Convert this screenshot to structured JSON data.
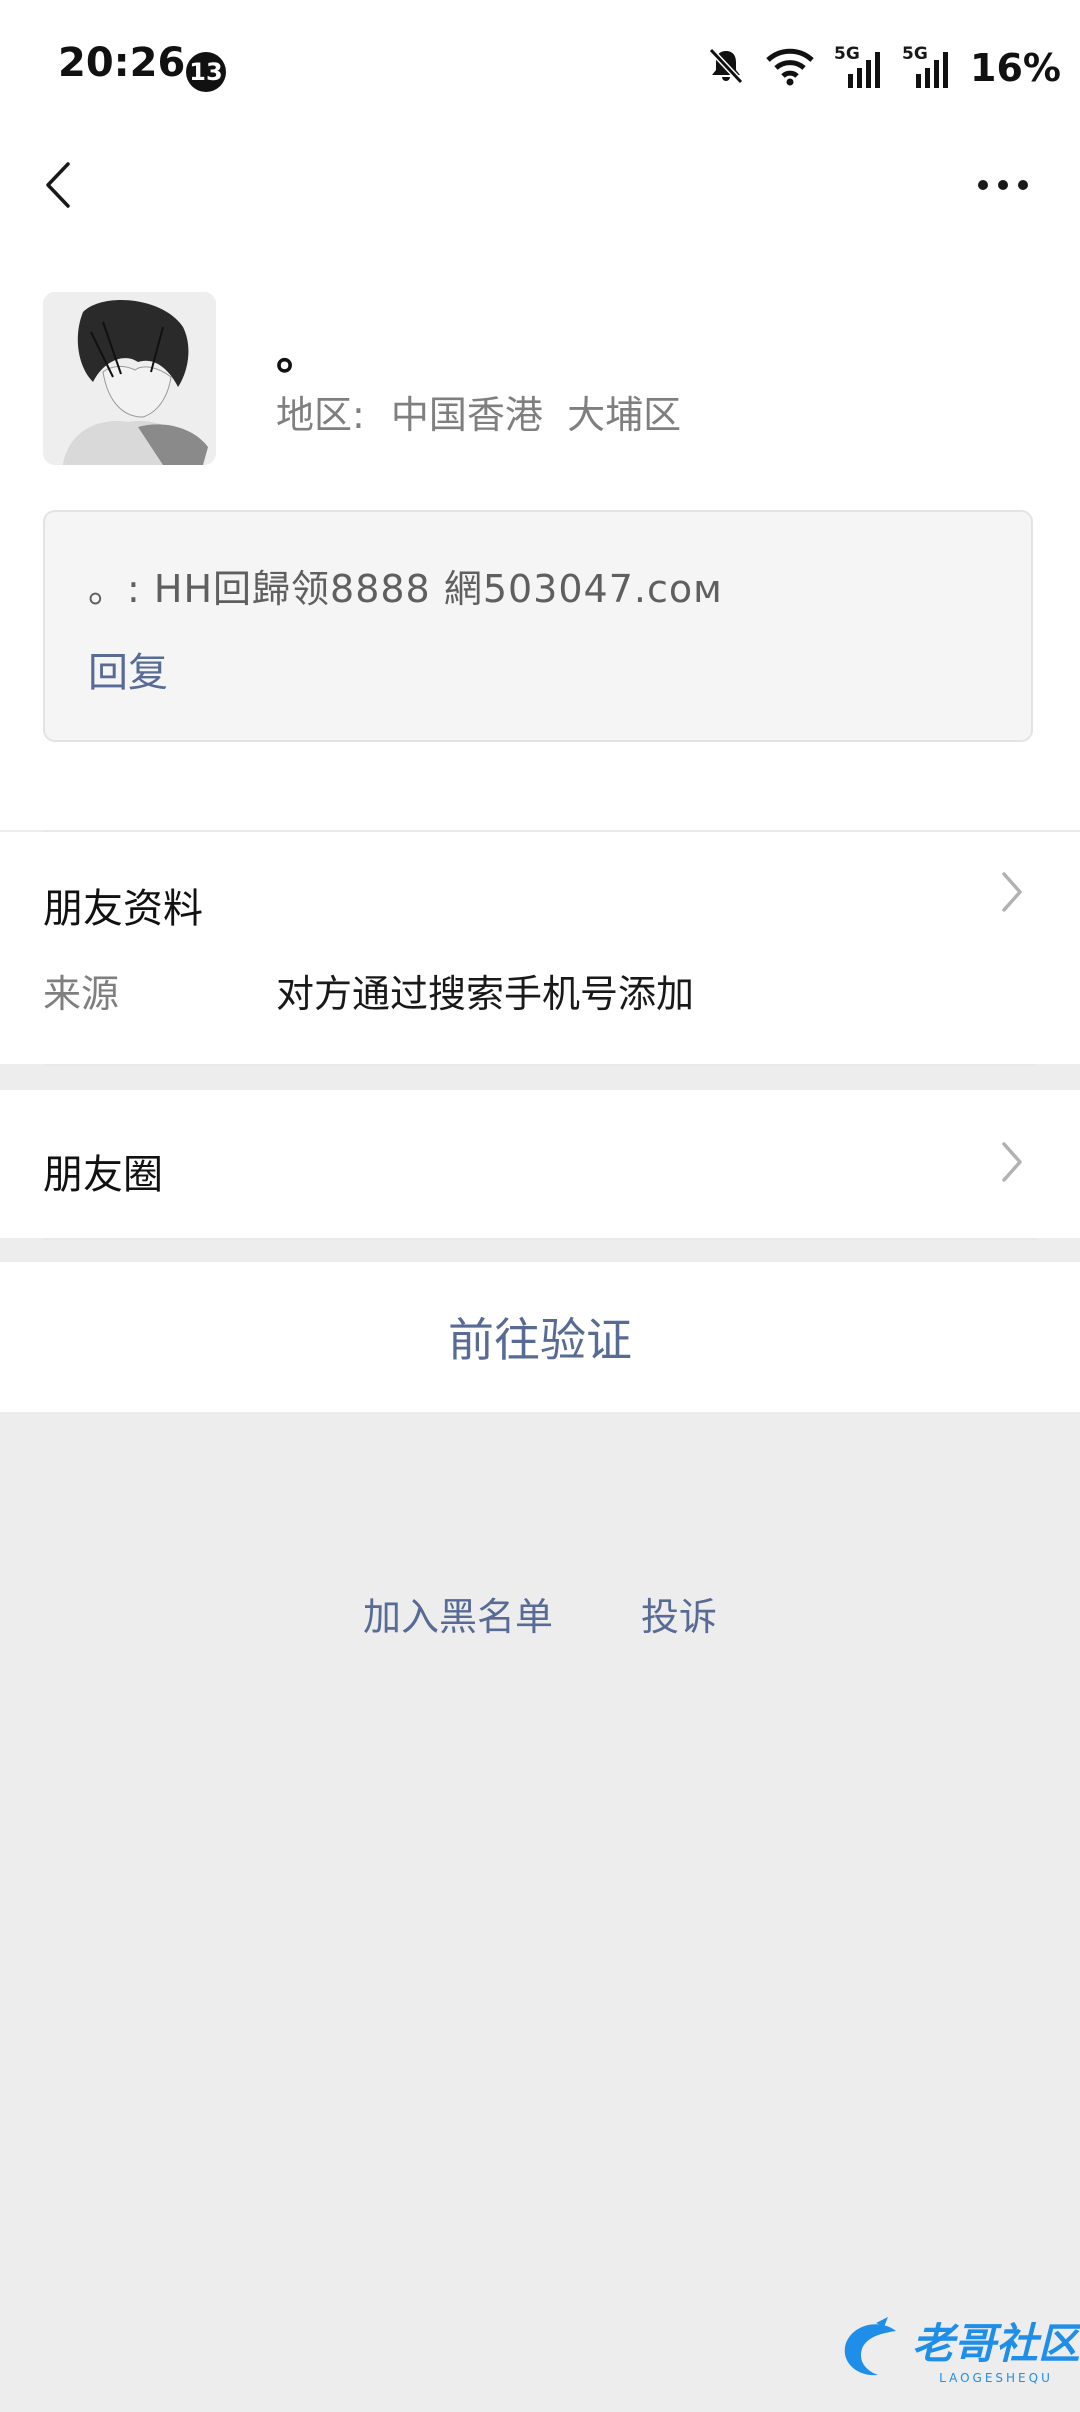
{
  "status_bar": {
    "time": "20:26",
    "notification_count": "13",
    "network1": "5G",
    "network2": "5G",
    "battery": "16%"
  },
  "profile": {
    "nickname": "。",
    "region_label": "地区:",
    "region_value": "中国香港  大埔区"
  },
  "message": {
    "text": "。: HH回歸领8888  網503047.cом",
    "reply_label": "回复"
  },
  "friend_info": {
    "title": "朋友资料",
    "source_label": "来源",
    "source_value": "对方通过搜索手机号添加"
  },
  "moments": {
    "title": "朋友圈"
  },
  "actions": {
    "verify_label": "前往验证",
    "blacklist_label": "加入黑名单",
    "report_label": "投诉"
  },
  "watermark": {
    "text": "老哥社区",
    "subtext": "LAOGESHEQU"
  },
  "colors": {
    "link": "#576b95",
    "background": "#ededed"
  }
}
